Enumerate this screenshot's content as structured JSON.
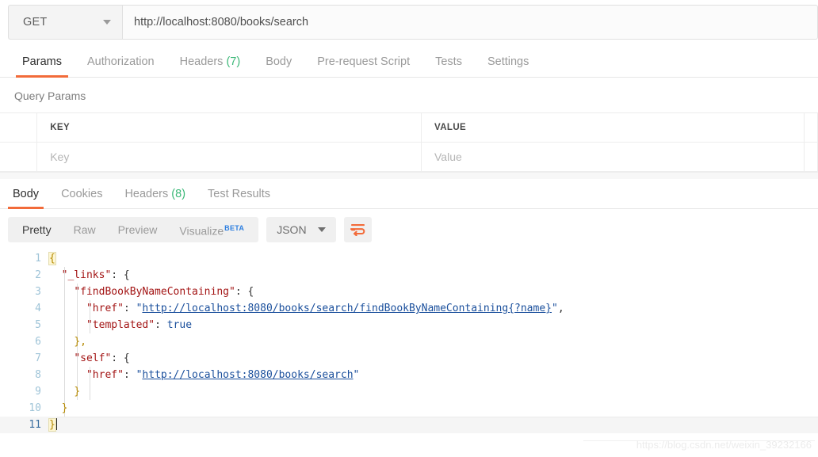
{
  "request": {
    "method": "GET",
    "url": "http://localhost:8080/books/search",
    "tabs": [
      {
        "label": "Params",
        "count": "",
        "active": true
      },
      {
        "label": "Authorization",
        "count": "",
        "active": false
      },
      {
        "label": "Headers",
        "count": "(7)",
        "active": false
      },
      {
        "label": "Body",
        "count": "",
        "active": false
      },
      {
        "label": "Pre-request Script",
        "count": "",
        "active": false
      },
      {
        "label": "Tests",
        "count": "",
        "active": false
      },
      {
        "label": "Settings",
        "count": "",
        "active": false
      }
    ]
  },
  "query_params": {
    "title": "Query Params",
    "headers": {
      "key": "KEY",
      "value": "VALUE"
    },
    "rows": [
      {
        "key_placeholder": "Key",
        "value_placeholder": "Value"
      }
    ]
  },
  "response": {
    "tabs": [
      {
        "label": "Body",
        "count": "",
        "active": true
      },
      {
        "label": "Cookies",
        "count": "",
        "active": false
      },
      {
        "label": "Headers",
        "count": "(8)",
        "active": false
      },
      {
        "label": "Test Results",
        "count": "",
        "active": false
      }
    ],
    "view_modes": [
      {
        "label": "Pretty",
        "active": true,
        "badge": ""
      },
      {
        "label": "Raw",
        "active": false,
        "badge": ""
      },
      {
        "label": "Preview",
        "active": false,
        "badge": ""
      },
      {
        "label": "Visualize",
        "active": false,
        "badge": "BETA"
      }
    ],
    "format": "JSON",
    "wrap_icon": "word-wrap-icon"
  },
  "body": {
    "lines": [
      {
        "n": "1",
        "active": false
      },
      {
        "n": "2",
        "active": false
      },
      {
        "n": "3",
        "active": false
      },
      {
        "n": "4",
        "active": false
      },
      {
        "n": "5",
        "active": false
      },
      {
        "n": "6",
        "active": false
      },
      {
        "n": "7",
        "active": false
      },
      {
        "n": "8",
        "active": false
      },
      {
        "n": "9",
        "active": false
      },
      {
        "n": "10",
        "active": false
      },
      {
        "n": "11",
        "active": true
      }
    ],
    "text": {
      "l1_brace": "{",
      "l2_key": "\"_links\"",
      "l2_rest": ": {",
      "l3_key": "\"findBookByNameContaining\"",
      "l3_rest": ": {",
      "l4_key": "\"href\"",
      "l4_sep": ": ",
      "l4_str": "http://localhost:8080/books/search/findBookByNameContaining{?name}",
      "l4_tail": ",",
      "l5_key": "\"templated\"",
      "l5_sep": ": ",
      "l5_val": "true",
      "l6_close": "},",
      "l7_key": "\"self\"",
      "l7_rest": ": {",
      "l8_key": "\"href\"",
      "l8_sep": ": ",
      "l8_str": "http://localhost:8080/books/search",
      "l9_close": "}",
      "l10_close": "}",
      "l11_close": "}"
    },
    "raw_json": "{\n  \"_links\": {\n    \"findBookByNameContaining\": {\n      \"href\": \"http://localhost:8080/books/search/findBookByNameContaining{?name}\",\n      \"templated\": true\n    },\n    \"self\": {\n      \"href\": \"http://localhost:8080/books/search\"\n    }\n  }\n}"
  },
  "watermark": "https://blog.csdn.net/weixin_39232166",
  "colors": {
    "accent_orange": "#f26b3a",
    "count_green": "#3cb878",
    "beta_blue": "#2e7fe0",
    "json_key": "#a31515",
    "json_string": "#1a4f9c",
    "line_number": "#9fc4d8"
  }
}
